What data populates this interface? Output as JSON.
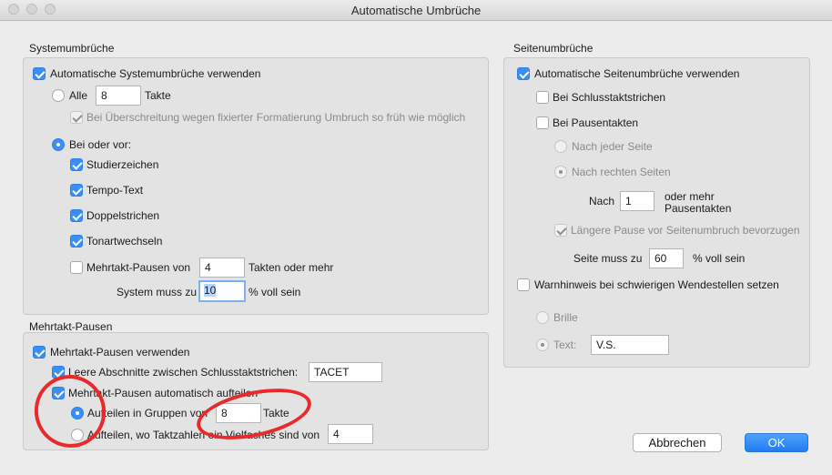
{
  "window": {
    "title": "Automatische Umbrüche"
  },
  "system": {
    "group_title": "Systemumbrüche",
    "use_auto": {
      "label": "Automatische Systemumbrüche verwenden",
      "checked": true
    },
    "all": {
      "label": "Alle",
      "value": "8",
      "unit": "Takte",
      "selected": false
    },
    "fixed_formatting": {
      "label": "Bei Überschreitung wegen fixierter Formatierung Umbruch so früh wie möglich",
      "checked": true,
      "disabled": true
    },
    "at_or_before": {
      "label": "Bei oder vor:",
      "selected": true
    },
    "rehearsal": {
      "label": "Studierzeichen",
      "checked": true
    },
    "tempo": {
      "label": "Tempo-Text",
      "checked": true
    },
    "double_bar": {
      "label": "Doppelstrichen",
      "checked": true
    },
    "key_change": {
      "label": "Tonartwechseln",
      "checked": true
    },
    "multirest": {
      "label": "Mehrtakt-Pausen von",
      "value": "4",
      "suffix": "Takten oder mehr",
      "checked": false
    },
    "fill": {
      "label": "System muss zu",
      "value": "10",
      "suffix": "% voll sein"
    }
  },
  "multirest_group": {
    "group_title": "Mehrtakt-Pausen",
    "use": {
      "label": "Mehrtakt-Pausen verwenden",
      "checked": true
    },
    "empty_sections": {
      "label": "Leere Abschnitte zwischen Schlusstaktstrichen:",
      "value": "TACET",
      "checked": true
    },
    "auto_split": {
      "label": "Mehrtakt-Pausen automatisch aufteilen",
      "checked": true
    },
    "split_groups": {
      "label": "Aufteilen in Gruppen von",
      "value": "8",
      "suffix": "Takte",
      "selected": true
    },
    "split_multiple": {
      "label": "Aufteilen, wo Taktzahlen ein Vielfaches sind von",
      "value": "4",
      "selected": false
    }
  },
  "page": {
    "group_title": "Seitenumbrüche",
    "use_auto": {
      "label": "Automatische Seitenumbrüche verwenden",
      "checked": true
    },
    "final_bars": {
      "label": "Bei Schlusstaktstrichen",
      "checked": false
    },
    "rest_bars": {
      "label": "Bei Pausentakten",
      "checked": false
    },
    "every_page": {
      "label": "Nach jeder Seite",
      "selected": false,
      "disabled": true
    },
    "right_pages": {
      "label": "Nach rechten Seiten",
      "selected": true,
      "disabled": true
    },
    "after": {
      "label": "Nach",
      "value": "1",
      "suffix_line1": "oder mehr",
      "suffix_line2": "Pausentakten"
    },
    "longer_rest": {
      "label": "Längere Pause vor Seitenumbruch bevorzugen",
      "checked": true,
      "disabled": true
    },
    "fill": {
      "label": "Seite muss zu",
      "value": "60",
      "suffix": "% voll sein"
    },
    "warning": {
      "label": "Warnhinweis bei schwierigen Wendestellen setzen",
      "checked": false
    },
    "glasses": {
      "label": "Brille",
      "selected": false,
      "disabled": true
    },
    "text": {
      "label": "Text:",
      "value": "V.S.",
      "selected": true,
      "disabled": true
    }
  },
  "buttons": {
    "cancel": "Abbrechen",
    "ok": "OK"
  },
  "annotations": {
    "color": "#ea2a2a"
  }
}
